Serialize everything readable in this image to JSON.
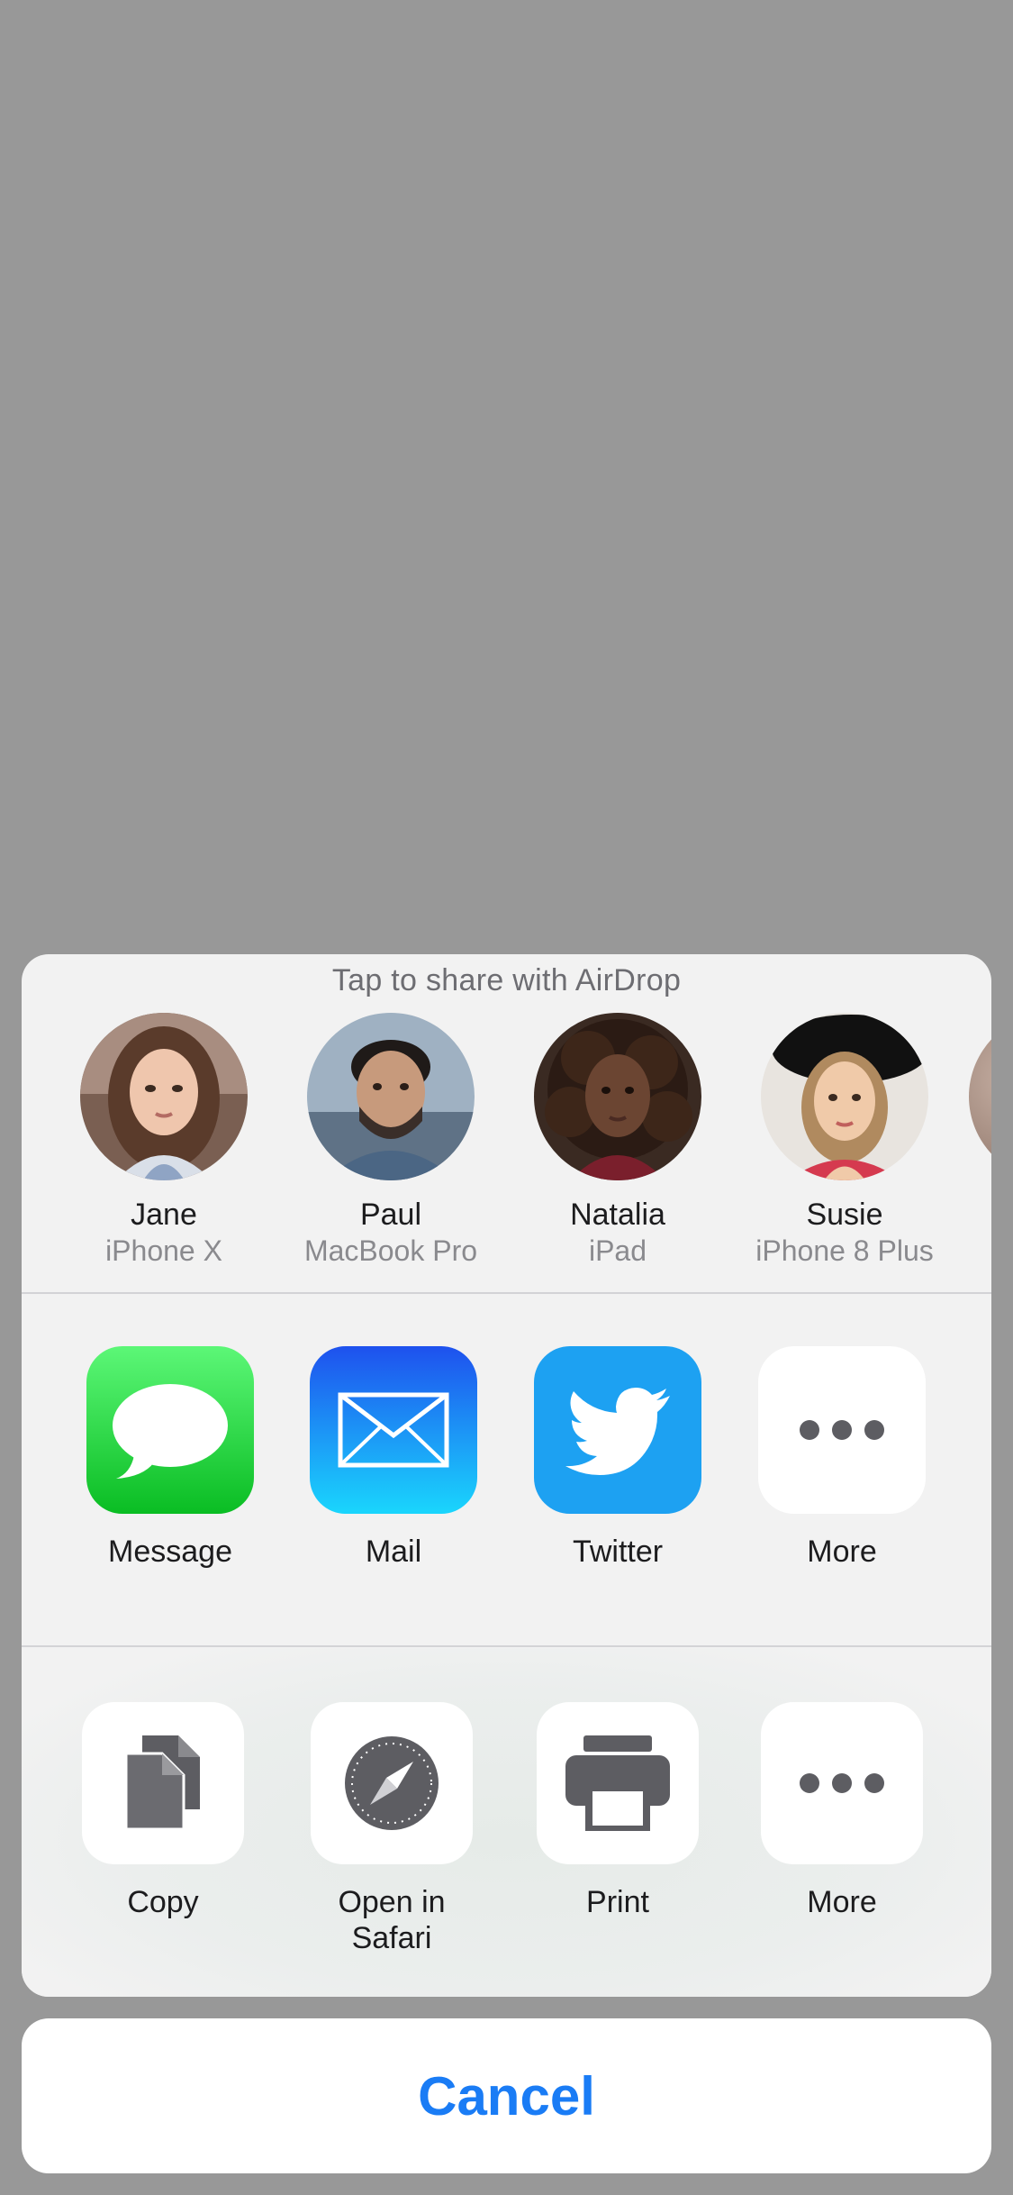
{
  "share_sheet": {
    "airdrop_title": "Tap to share with AirDrop",
    "people": [
      {
        "name": "Jane",
        "device": "iPhone X"
      },
      {
        "name": "Paul",
        "device": "MacBook Pro"
      },
      {
        "name": "Natalia",
        "device": "iPad"
      },
      {
        "name": "Susie",
        "device": "iPhone 8 Plus"
      }
    ],
    "apps": [
      {
        "label": "Message",
        "icon": "message-icon"
      },
      {
        "label": "Mail",
        "icon": "mail-icon"
      },
      {
        "label": "Twitter",
        "icon": "twitter-icon"
      },
      {
        "label": "More",
        "icon": "more-icon"
      }
    ],
    "actions": [
      {
        "label": "Copy",
        "icon": "copy-icon"
      },
      {
        "label": "Open in\nSafari",
        "icon": "safari-icon"
      },
      {
        "label": "Print",
        "icon": "print-icon"
      },
      {
        "label": "More",
        "icon": "more-icon"
      }
    ]
  },
  "cancel_label": "Cancel",
  "colors": {
    "accent": "#1a7cf5",
    "message_green": "#0abd23",
    "mail_blue": "#1e51ee",
    "twitter_blue": "#1da1f2",
    "backdrop": "#989898"
  }
}
